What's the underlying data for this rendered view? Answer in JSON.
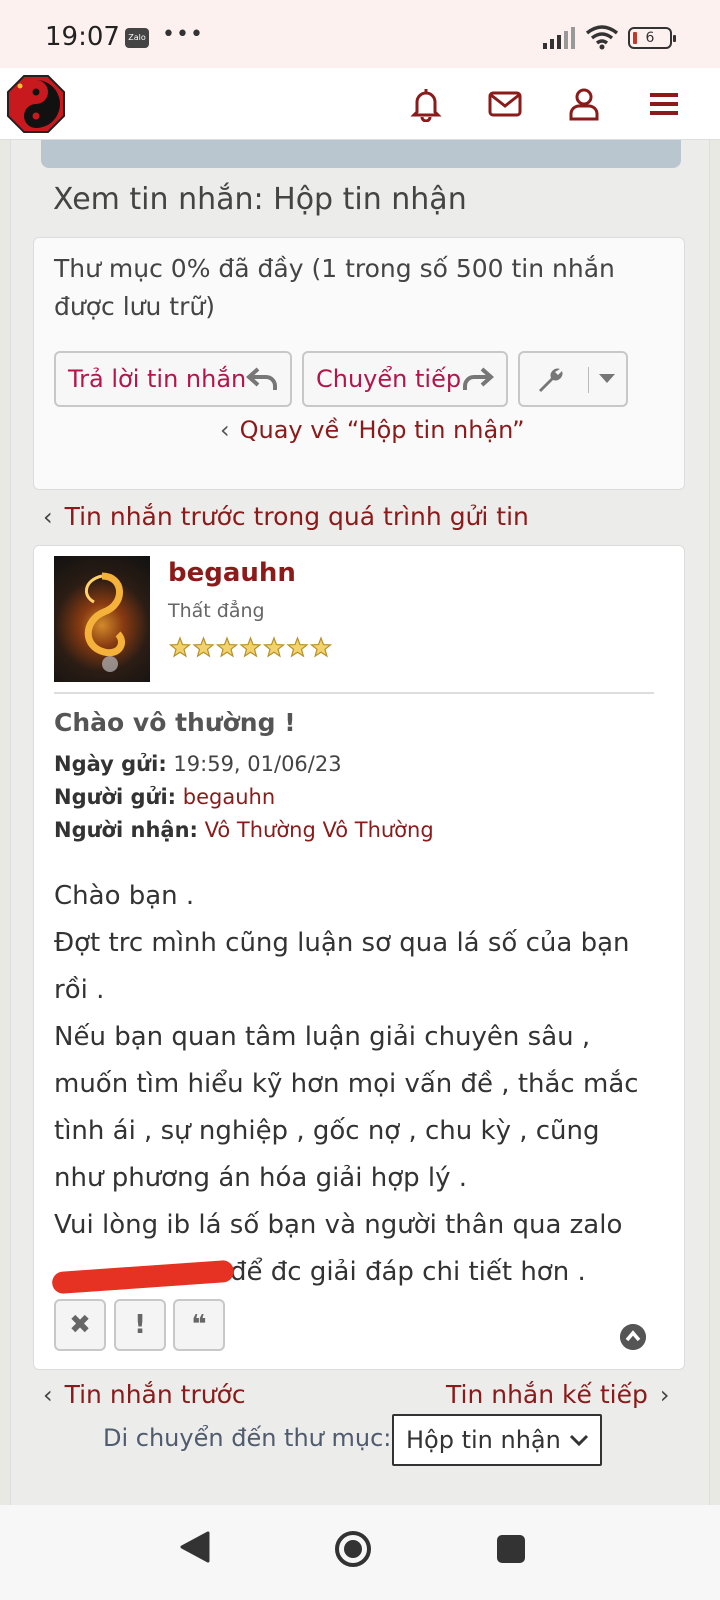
{
  "status_bar": {
    "time": "19:07",
    "app_badge": "Zalo",
    "more": "•••",
    "battery": "6"
  },
  "header": {
    "icons": [
      "logo-icon",
      "bell-icon",
      "mail-icon",
      "user-icon",
      "menu-icon"
    ],
    "accent_color": "#8b1a1a"
  },
  "page": {
    "title": "Xem tin nhắn: Hộp tin nhận",
    "folder_status": "Thư mục 0% đã đầy (1 trong số 500 tin nhắn được lưu trữ)",
    "reply_button": "Trả lời tin nhắn",
    "forward_button": "Chuyển tiếp",
    "back_link": "Quay về “Hộp tin nhận”",
    "prev_in_thread": "Tin nhắn trước trong quá trình gửi tin"
  },
  "message": {
    "username": "begauhn",
    "rank": "Thất đẳng",
    "stars": 7,
    "subject": "Chào vô thường !",
    "date_label": "Ngày gửi:",
    "date_value": "19:59, 01/06/23",
    "from_label": "Người gửi:",
    "from_value": "begauhn",
    "to_label": "Người nhận:",
    "to_value": "Vô Thường Vô Thường",
    "body_lines": [
      "Chào bạn .",
      "Đợt trc mình cũng luận sơ qua lá số của bạn rồi .",
      "Nếu bạn quan tâm luận giải chuyên sâu , muốn tìm hiểu kỹ hơn mọi vấn đề , thắc mắc tình ái , sự nghiệp , gốc nợ , chu kỳ , cũng như phương án hóa giải hợp lý .",
      "Vui lòng ib lá số bạn và người thân qua zalo",
      "để đc giải đáp chi tiết hơn ."
    ],
    "action_icons": [
      "delete-icon",
      "report-icon",
      "quote-icon"
    ]
  },
  "pager": {
    "prev": "Tin nhắn trước",
    "next": "Tin nhắn kế tiếp"
  },
  "move": {
    "label": "Di chuyển đến thư mục:",
    "selected": "Hộp tin nhận"
  },
  "navbar": {
    "icons": [
      "back-icon",
      "home-icon",
      "recents-icon"
    ]
  }
}
